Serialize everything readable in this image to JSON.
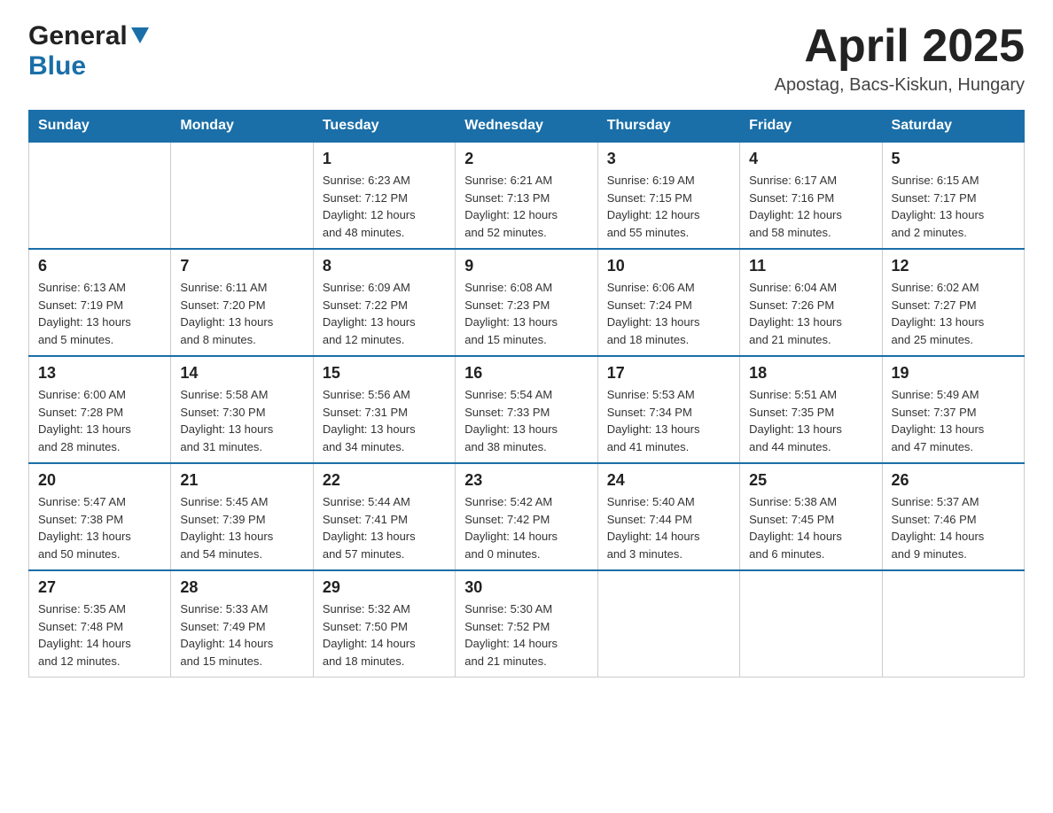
{
  "header": {
    "logo_general": "General",
    "logo_blue": "Blue",
    "title": "April 2025",
    "subtitle": "Apostag, Bacs-Kiskun, Hungary"
  },
  "days_of_week": [
    "Sunday",
    "Monday",
    "Tuesday",
    "Wednesday",
    "Thursday",
    "Friday",
    "Saturday"
  ],
  "weeks": [
    [
      {
        "day": "",
        "info": ""
      },
      {
        "day": "",
        "info": ""
      },
      {
        "day": "1",
        "info": "Sunrise: 6:23 AM\nSunset: 7:12 PM\nDaylight: 12 hours\nand 48 minutes."
      },
      {
        "day": "2",
        "info": "Sunrise: 6:21 AM\nSunset: 7:13 PM\nDaylight: 12 hours\nand 52 minutes."
      },
      {
        "day": "3",
        "info": "Sunrise: 6:19 AM\nSunset: 7:15 PM\nDaylight: 12 hours\nand 55 minutes."
      },
      {
        "day": "4",
        "info": "Sunrise: 6:17 AM\nSunset: 7:16 PM\nDaylight: 12 hours\nand 58 minutes."
      },
      {
        "day": "5",
        "info": "Sunrise: 6:15 AM\nSunset: 7:17 PM\nDaylight: 13 hours\nand 2 minutes."
      }
    ],
    [
      {
        "day": "6",
        "info": "Sunrise: 6:13 AM\nSunset: 7:19 PM\nDaylight: 13 hours\nand 5 minutes."
      },
      {
        "day": "7",
        "info": "Sunrise: 6:11 AM\nSunset: 7:20 PM\nDaylight: 13 hours\nand 8 minutes."
      },
      {
        "day": "8",
        "info": "Sunrise: 6:09 AM\nSunset: 7:22 PM\nDaylight: 13 hours\nand 12 minutes."
      },
      {
        "day": "9",
        "info": "Sunrise: 6:08 AM\nSunset: 7:23 PM\nDaylight: 13 hours\nand 15 minutes."
      },
      {
        "day": "10",
        "info": "Sunrise: 6:06 AM\nSunset: 7:24 PM\nDaylight: 13 hours\nand 18 minutes."
      },
      {
        "day": "11",
        "info": "Sunrise: 6:04 AM\nSunset: 7:26 PM\nDaylight: 13 hours\nand 21 minutes."
      },
      {
        "day": "12",
        "info": "Sunrise: 6:02 AM\nSunset: 7:27 PM\nDaylight: 13 hours\nand 25 minutes."
      }
    ],
    [
      {
        "day": "13",
        "info": "Sunrise: 6:00 AM\nSunset: 7:28 PM\nDaylight: 13 hours\nand 28 minutes."
      },
      {
        "day": "14",
        "info": "Sunrise: 5:58 AM\nSunset: 7:30 PM\nDaylight: 13 hours\nand 31 minutes."
      },
      {
        "day": "15",
        "info": "Sunrise: 5:56 AM\nSunset: 7:31 PM\nDaylight: 13 hours\nand 34 minutes."
      },
      {
        "day": "16",
        "info": "Sunrise: 5:54 AM\nSunset: 7:33 PM\nDaylight: 13 hours\nand 38 minutes."
      },
      {
        "day": "17",
        "info": "Sunrise: 5:53 AM\nSunset: 7:34 PM\nDaylight: 13 hours\nand 41 minutes."
      },
      {
        "day": "18",
        "info": "Sunrise: 5:51 AM\nSunset: 7:35 PM\nDaylight: 13 hours\nand 44 minutes."
      },
      {
        "day": "19",
        "info": "Sunrise: 5:49 AM\nSunset: 7:37 PM\nDaylight: 13 hours\nand 47 minutes."
      }
    ],
    [
      {
        "day": "20",
        "info": "Sunrise: 5:47 AM\nSunset: 7:38 PM\nDaylight: 13 hours\nand 50 minutes."
      },
      {
        "day": "21",
        "info": "Sunrise: 5:45 AM\nSunset: 7:39 PM\nDaylight: 13 hours\nand 54 minutes."
      },
      {
        "day": "22",
        "info": "Sunrise: 5:44 AM\nSunset: 7:41 PM\nDaylight: 13 hours\nand 57 minutes."
      },
      {
        "day": "23",
        "info": "Sunrise: 5:42 AM\nSunset: 7:42 PM\nDaylight: 14 hours\nand 0 minutes."
      },
      {
        "day": "24",
        "info": "Sunrise: 5:40 AM\nSunset: 7:44 PM\nDaylight: 14 hours\nand 3 minutes."
      },
      {
        "day": "25",
        "info": "Sunrise: 5:38 AM\nSunset: 7:45 PM\nDaylight: 14 hours\nand 6 minutes."
      },
      {
        "day": "26",
        "info": "Sunrise: 5:37 AM\nSunset: 7:46 PM\nDaylight: 14 hours\nand 9 minutes."
      }
    ],
    [
      {
        "day": "27",
        "info": "Sunrise: 5:35 AM\nSunset: 7:48 PM\nDaylight: 14 hours\nand 12 minutes."
      },
      {
        "day": "28",
        "info": "Sunrise: 5:33 AM\nSunset: 7:49 PM\nDaylight: 14 hours\nand 15 minutes."
      },
      {
        "day": "29",
        "info": "Sunrise: 5:32 AM\nSunset: 7:50 PM\nDaylight: 14 hours\nand 18 minutes."
      },
      {
        "day": "30",
        "info": "Sunrise: 5:30 AM\nSunset: 7:52 PM\nDaylight: 14 hours\nand 21 minutes."
      },
      {
        "day": "",
        "info": ""
      },
      {
        "day": "",
        "info": ""
      },
      {
        "day": "",
        "info": ""
      }
    ]
  ]
}
